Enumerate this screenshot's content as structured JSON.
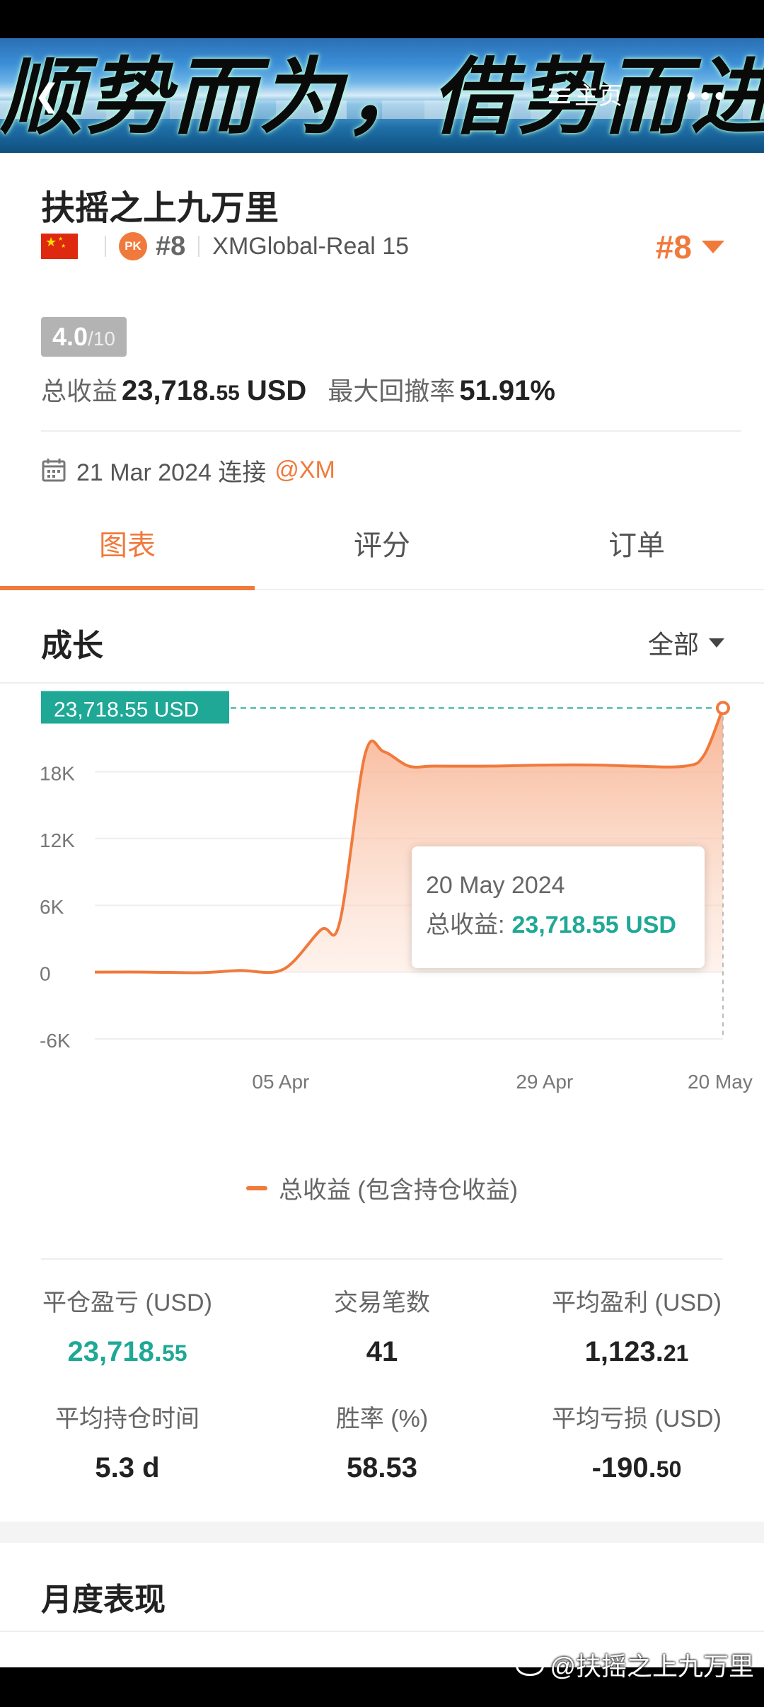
{
  "banner": {
    "calligraphy": "顺势而为，借势而进",
    "home_label": "主页"
  },
  "profile": {
    "title": "扶摇之上九万里",
    "rank": "#8",
    "broker": "XMGlobal-Real 15",
    "rank_right": "#8",
    "score": "4.0",
    "score_max": "/10",
    "total_profit_label": "总收益",
    "total_profit_int": "23,718.",
    "total_profit_dec": "55",
    "total_profit_unit": "USD",
    "max_drawdown_label": "最大回撤率",
    "max_drawdown": "51.91%",
    "connect_date": "21 Mar 2024 连接",
    "connect_source": "@XM"
  },
  "tabs": [
    {
      "label": "图表",
      "active": true
    },
    {
      "label": "评分",
      "active": false
    },
    {
      "label": "订单",
      "active": false
    }
  ],
  "section": {
    "title": "成长",
    "filter": "全部"
  },
  "chart_data": {
    "type": "area",
    "x": [
      "21 Mar",
      "25 Mar",
      "29 Mar",
      "01 Apr",
      "05 Apr",
      "08 Apr",
      "10 Apr",
      "12 Apr",
      "14 Apr",
      "16 Apr",
      "18 Apr",
      "23 Apr",
      "29 Apr",
      "05 May",
      "10 May",
      "16 May",
      "18 May",
      "20 May"
    ],
    "series": [
      {
        "name": "总收益 (包含持仓收益)",
        "values": [
          0,
          0,
          -50,
          150,
          250,
          3800,
          4500,
          19500,
          19800,
          18500,
          18500,
          18500,
          18600,
          18600,
          18500,
          18500,
          19500,
          23718.55
        ]
      }
    ],
    "x_ticks": [
      "05 Apr",
      "29 Apr",
      "20 May"
    ],
    "y_ticks": [
      "-6K",
      "0",
      "6K",
      "12K",
      "18K"
    ],
    "ylim": [
      -6000,
      24000
    ],
    "current_value_label": "23,718.55 USD",
    "tooltip": {
      "date": "20 May 2024",
      "label": "总收益:",
      "value": "23,718.55 USD"
    },
    "colors": {
      "line": "#f07a3c",
      "fill": "#fbd3c0",
      "marker": "#1fa896"
    }
  },
  "legend": {
    "label": "总收益 (包含持仓收益)"
  },
  "stats": [
    {
      "label": "平仓盈亏 (USD)",
      "int": "23,718.",
      "dec": "55",
      "green": true
    },
    {
      "label": "交易笔数",
      "int": "41",
      "dec": "",
      "green": false
    },
    {
      "label": "平均盈利 (USD)",
      "int": "1,123.",
      "dec": "21",
      "green": false
    },
    {
      "label": "平均持仓时间",
      "int": "5.3 d",
      "dec": "",
      "green": false
    },
    {
      "label": "胜率 (%)",
      "int": "58.53",
      "dec": "",
      "green": false
    },
    {
      "label": "平均亏损 (USD)",
      "int": "-190.",
      "dec": "50",
      "green": false
    }
  ],
  "monthly": {
    "title": "月度表现"
  },
  "watermark": {
    "text": "@扶摇之上九万里"
  }
}
